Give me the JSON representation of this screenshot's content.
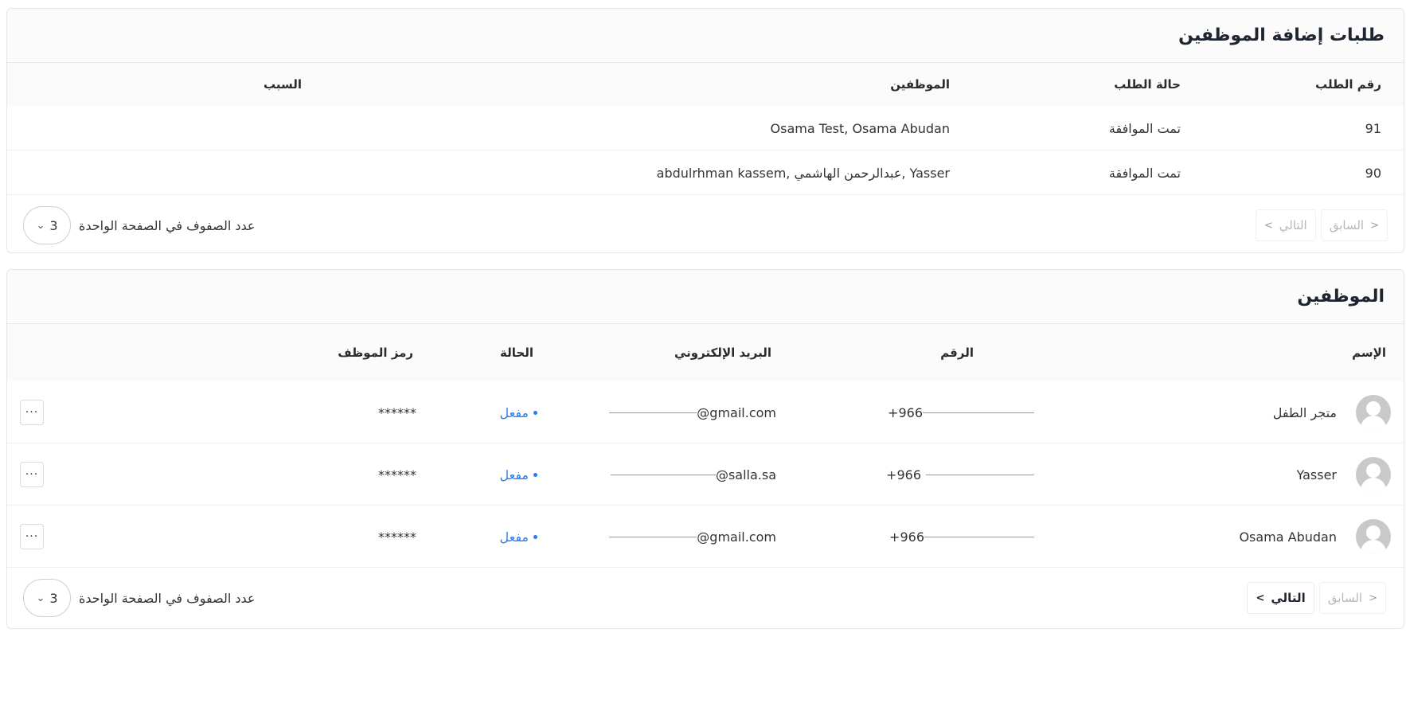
{
  "requests_card": {
    "title": "طلبات إضافة الموظفين",
    "headers": {
      "id": "رقم الطلب",
      "status": "حالة الطلب",
      "employees": "الموظفين",
      "reason": "السبب"
    },
    "rows": [
      {
        "id": "91",
        "status": "تمت الموافقة",
        "employees": "Osama Test, Osama Abudan",
        "reason": ""
      },
      {
        "id": "90",
        "status": "تمت الموافقة",
        "employees": "abdulrhman kassem, عبدالرحمن الهاشمي, Yasser",
        "reason": ""
      }
    ],
    "pagination": {
      "prev": "السابق",
      "next": "التالي"
    },
    "rows_per_page": {
      "label": "عدد الصفوف في الصفحة الواحدة",
      "value": "3"
    }
  },
  "employees_card": {
    "title": "الموظفين",
    "headers": {
      "name": "الإسم",
      "phone": "الرقم",
      "email": "البريد الإلكتروني",
      "status": "الحالة",
      "code": "رمز الموظف"
    },
    "rows": [
      {
        "name": "متجر الطفل",
        "phone": "+966",
        "email": "@gmail.com",
        "status": "مفعل",
        "code": "******",
        "more": "···"
      },
      {
        "name": "Yasser",
        "phone": "+966",
        "email": "@salla.sa",
        "status": "مفعل",
        "code": "******",
        "more": "···"
      },
      {
        "name": "Osama Abudan",
        "phone": "+966",
        "email": "@gmail.com",
        "status": "مفعل",
        "code": "******",
        "more": "···"
      }
    ],
    "pagination": {
      "prev": "السابق",
      "next": "التالي"
    },
    "rows_per_page": {
      "label": "عدد الصفوف في الصفحة الواحدة",
      "value": "3"
    }
  },
  "icons": {
    "chevron_prev": "chevron-right-icon",
    "chevron_next": "chevron-left-icon",
    "chevron_down": "chevron-down-icon"
  },
  "colors": {
    "accent": "#2f7be5",
    "title": "#1e2530"
  }
}
